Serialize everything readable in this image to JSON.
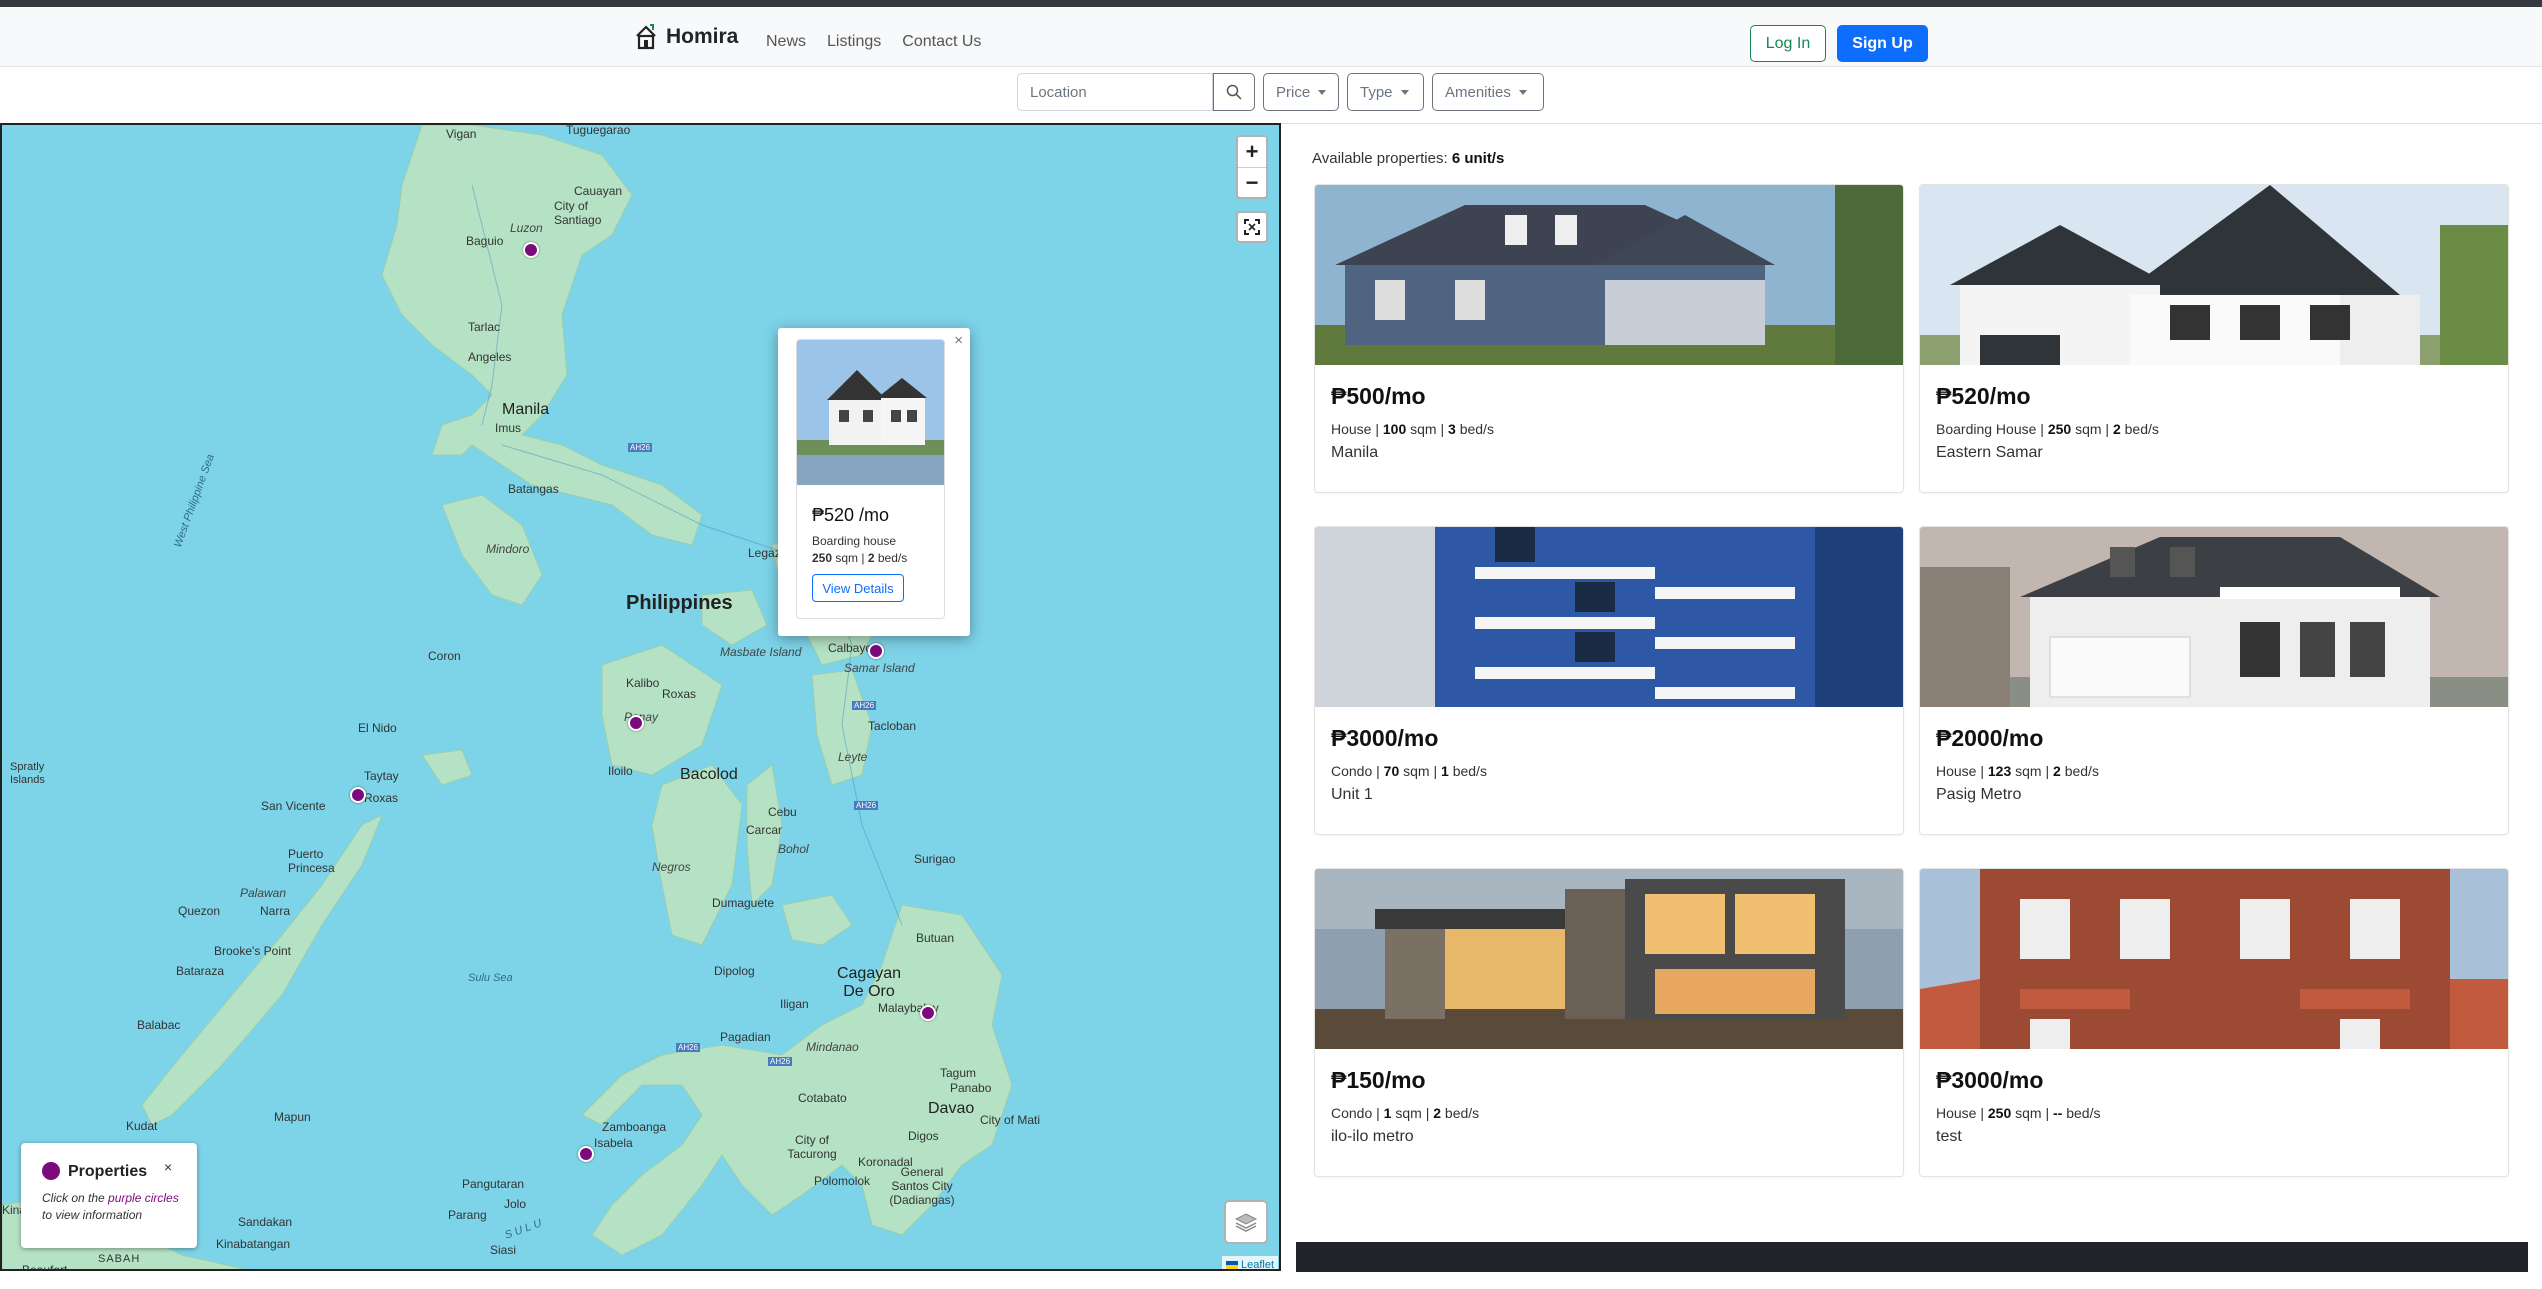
{
  "brand": {
    "name": "Homira"
  },
  "nav": {
    "links": [
      "News",
      "Listings",
      "Contact Us"
    ],
    "login": "Log In",
    "signup": "Sign Up"
  },
  "filters": {
    "location_placeholder": "Location",
    "price": "Price",
    "type": "Type",
    "amenities": "Amenities"
  },
  "map": {
    "labels": {
      "vigan": "Vigan",
      "tuguegarao": "Tuguegarao",
      "cauayan": "Cauayan",
      "city_of_santiago": "City of Santiago",
      "luzon": "Luzon",
      "baguio": "Baguio",
      "tarlac": "Tarlac",
      "angeles": "Angeles",
      "manila": "Manila",
      "imus": "Imus",
      "batangas": "Batangas",
      "mindoro": "Mindoro",
      "legazpi": "Legazpi",
      "west_philippine_sea": "West Philippine Sea",
      "philippines": "Philippines",
      "masbate": "Masbate Island",
      "calbayog": "Calbayog",
      "samar": "Samar Island",
      "coron": "Coron",
      "kalibo": "Kalibo",
      "roxas": "Roxas",
      "panay": "Panay",
      "tacloban": "Tacloban",
      "el_nido": "El Nido",
      "iloilo": "Iloilo",
      "leyte": "Leyte",
      "bacolod": "Bacolod",
      "taytay": "Taytay",
      "roxas2": "Roxas",
      "cebu": "Cebu",
      "carcar": "Carcar",
      "spratly": "Spratly Islands",
      "san_vicente": "San Vicente",
      "bohol": "Bohol",
      "surigao": "Surigao",
      "puerto_princesa": "Puerto Princesa",
      "negros": "Negros",
      "palawan": "Palawan",
      "dumaguete": "Dumaguete",
      "quezon": "Quezon",
      "narra": "Narra",
      "brookes_point": "Brooke's Point",
      "butuan": "Butuan",
      "bataraza": "Bataraza",
      "sulu_sea": "Sulu Sea",
      "dipolog": "Dipolog",
      "cagayan_de_oro": "Cagayan De Oro",
      "balabac": "Balabac",
      "iligan": "Iligan",
      "malaybalay": "Malaybalay",
      "pagadian": "Pagadian",
      "mindanao": "Mindanao",
      "tagum": "Tagum",
      "panabo": "Panabo",
      "mapun": "Mapun",
      "cotabato": "Cotabato",
      "davao": "Davao",
      "city_of_mati": "City of Mati",
      "kudat": "Kudat",
      "zamboanga": "Zamboanga",
      "isabela": "Isabela",
      "city_of_tacurong": "City of Tacurong",
      "digos": "Digos",
      "koronadal": "Koronadal",
      "polomolok": "Polomolok",
      "general_santos": "General Santos City (Dadiangas)",
      "pangutaran": "Pangutaran",
      "parang": "Parang",
      "jolo": "Jolo",
      "sulu": "SULU",
      "sandakan": "Sandakan",
      "siasi": "Siasi",
      "kinabatangan": "Kinabatangan",
      "sabah": "SABAH",
      "beaufort": "Beaufort",
      "kina": "Kina",
      "ah26_1": "AH26",
      "ah26_2": "AH26",
      "ah26_3": "AH26",
      "ah26_4": "AH26",
      "ah26_5": "AH26"
    },
    "zoom_in": "+",
    "zoom_out": "−",
    "attribution": "Leaflet",
    "marker_color": "#7b0a7d"
  },
  "popup": {
    "close": "×",
    "price": "₱520 /mo",
    "type": "Boarding house",
    "sqm": "250",
    "sqm_unit": "sqm |",
    "beds": "2",
    "beds_unit": "bed/s",
    "button": "View Details"
  },
  "legend": {
    "title": "Properties",
    "close": "×",
    "hint_pre": "Click on the ",
    "hint_link": "purple circles",
    "hint_post": " to view information"
  },
  "listings": {
    "available_label": "Available properties:",
    "available_count": "6 unit/s",
    "cards": [
      {
        "price": "₱500/mo",
        "type": "House |",
        "sqm": "100",
        "beds": "3",
        "location": "Manila"
      },
      {
        "price": "₱520/mo",
        "type": "Boarding House |",
        "sqm": "250",
        "beds": "2",
        "location": "Eastern Samar"
      },
      {
        "price": "₱3000/mo",
        "type": "Condo |",
        "sqm": "70",
        "beds": "1",
        "location": "Unit 1"
      },
      {
        "price": "₱2000/mo",
        "type": "House |",
        "sqm": "123",
        "beds": "2",
        "location": "Pasig Metro"
      },
      {
        "price": "₱150/mo",
        "type": "Condo |",
        "sqm": "1",
        "beds": "2",
        "location": "ilo-ilo metro"
      },
      {
        "price": "₱3000/mo",
        "type": "House |",
        "sqm": "250",
        "beds": "--",
        "location": "test"
      }
    ],
    "sqm_unit": "sqm |",
    "beds_unit": "bed/s"
  },
  "colors": {
    "primary": "#0d6efd",
    "success": "#198754",
    "sea": "#7dd3e8",
    "land": "#b5e2c4",
    "dark": "#212529"
  }
}
